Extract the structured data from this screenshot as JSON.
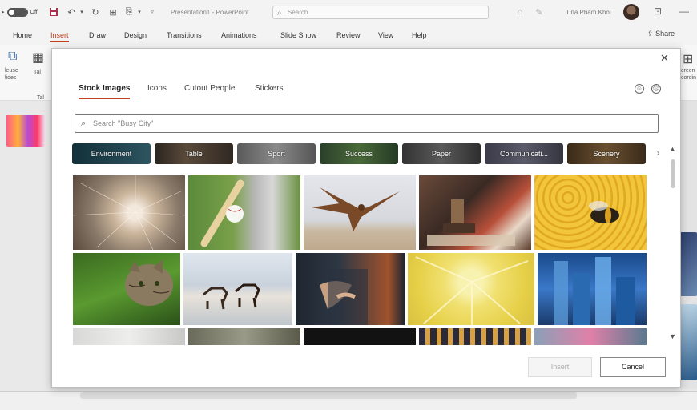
{
  "titlebar": {
    "autosave_label": "Off",
    "doc_title": "Presentation1 - PowerPoint",
    "search_placeholder": "Search",
    "user_name": "Tina Pham Khoi"
  },
  "ribbon": {
    "tabs": [
      {
        "label": "Home",
        "active": false
      },
      {
        "label": "Insert",
        "active": true
      },
      {
        "label": "Draw",
        "active": false
      },
      {
        "label": "Design",
        "active": false
      },
      {
        "label": "Transitions",
        "active": false
      },
      {
        "label": "Animations",
        "active": false
      },
      {
        "label": "Slide Show",
        "active": false
      },
      {
        "label": "Review",
        "active": false
      },
      {
        "label": "View",
        "active": false
      },
      {
        "label": "Help",
        "active": false
      }
    ],
    "share_label": "Share",
    "left_group_text": [
      "leuse",
      "lides"
    ],
    "left_group_text2": [
      "Tal",
      "Tal"
    ],
    "right_group_text": [
      "creen",
      "cordin"
    ]
  },
  "dialog": {
    "tabs": [
      {
        "label": "Stock Images",
        "active": true
      },
      {
        "label": "Icons",
        "active": false
      },
      {
        "label": "Cutout People",
        "active": false
      },
      {
        "label": "Stickers",
        "active": false
      }
    ],
    "search_placeholder": "Search \"Busy City\"",
    "categories": [
      {
        "label": "Environment",
        "color": "#1f3a45"
      },
      {
        "label": "Table",
        "color": "#3a3530"
      },
      {
        "label": "Sport",
        "color": "#6a6a6a"
      },
      {
        "label": "Success",
        "color": "#2f4a2f"
      },
      {
        "label": "Paper",
        "color": "#404040"
      },
      {
        "label": "Communicati...",
        "color": "#4a4a55"
      },
      {
        "label": "Scenery",
        "color": "#4a3a28"
      }
    ],
    "images": [
      {
        "subject": "dandelion seed head close-up"
      },
      {
        "subject": "baseball bat hitting ball"
      },
      {
        "subject": "hawk flying over beach"
      },
      {
        "subject": "hand stamping document"
      },
      {
        "subject": "bee on honeycomb"
      },
      {
        "subject": "cat in green grass"
      },
      {
        "subject": "horses running on beach"
      },
      {
        "subject": "businessman in suit"
      },
      {
        "subject": "lemon slice close-up"
      },
      {
        "subject": "blue glass skyscrapers"
      },
      {
        "subject": "interior room"
      },
      {
        "subject": "textured surface"
      },
      {
        "subject": "dark scene"
      },
      {
        "subject": "wooden chairs pattern"
      },
      {
        "subject": "lotus flower"
      }
    ],
    "insert_label": "Insert",
    "cancel_label": "Cancel"
  }
}
